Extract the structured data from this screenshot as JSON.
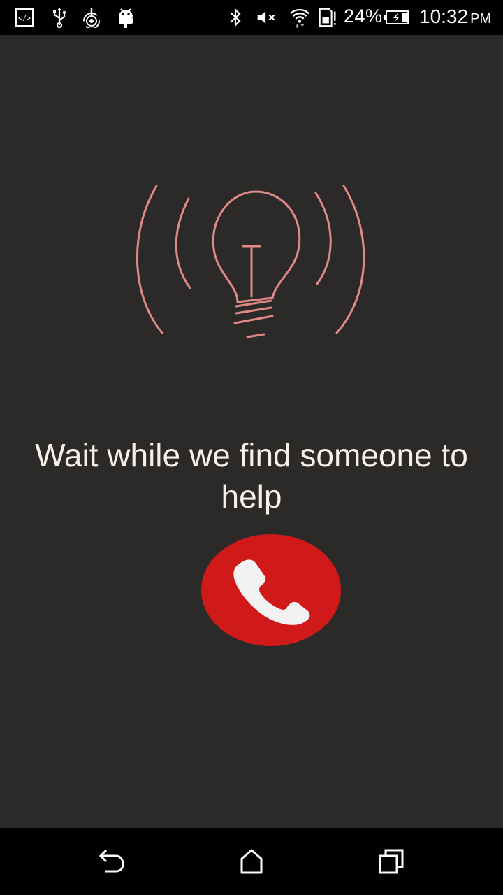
{
  "status_bar": {
    "icons": [
      "developer-icon",
      "usb-icon",
      "hotspot-icon",
      "android-icon",
      "bluetooth-icon",
      "mute-icon",
      "wifi-icon",
      "sim-alert-icon",
      "battery-charging-icon"
    ],
    "battery_percent": "24%",
    "time": "10:32",
    "ampm": "PM"
  },
  "main": {
    "message": "Wait while we find someone to help",
    "illustration": "lightbulb-ringing-icon",
    "call_button_icon": "phone-icon"
  },
  "colors": {
    "background": "#2b2a29",
    "bulb_stroke": "#e08a86",
    "call_button": "#d01a1a",
    "text": "#f7f1e8"
  },
  "nav_bar": {
    "buttons": [
      "back-icon",
      "home-icon",
      "recent-apps-icon"
    ]
  }
}
